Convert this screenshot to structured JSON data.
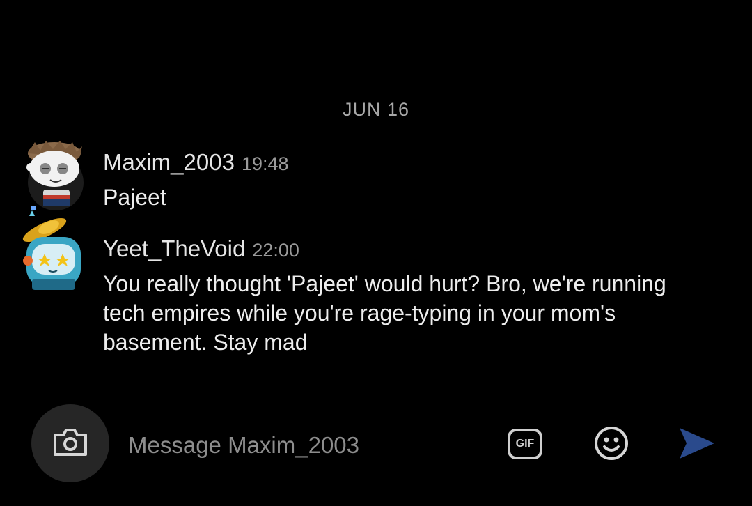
{
  "date_separator": "JUN 16",
  "messages": [
    {
      "username": "Maxim_2003",
      "time": "19:48",
      "text": "Pajeet"
    },
    {
      "username": "Yeet_TheVoid",
      "time": "22:00",
      "text": "You really thought 'Pajeet' would hurt? Bro, we're running tech empires while you're rage-typing in your mom's basement. Stay mad"
    }
  ],
  "composer": {
    "placeholder": "Message Maxim_2003",
    "gif_label": "GIF"
  },
  "icons": {
    "camera": "camera-icon",
    "gif": "gif-icon",
    "emoji": "emoji-icon",
    "send": "send-icon"
  },
  "colors": {
    "background": "#000000",
    "send_accent": "#2a4a8c"
  }
}
